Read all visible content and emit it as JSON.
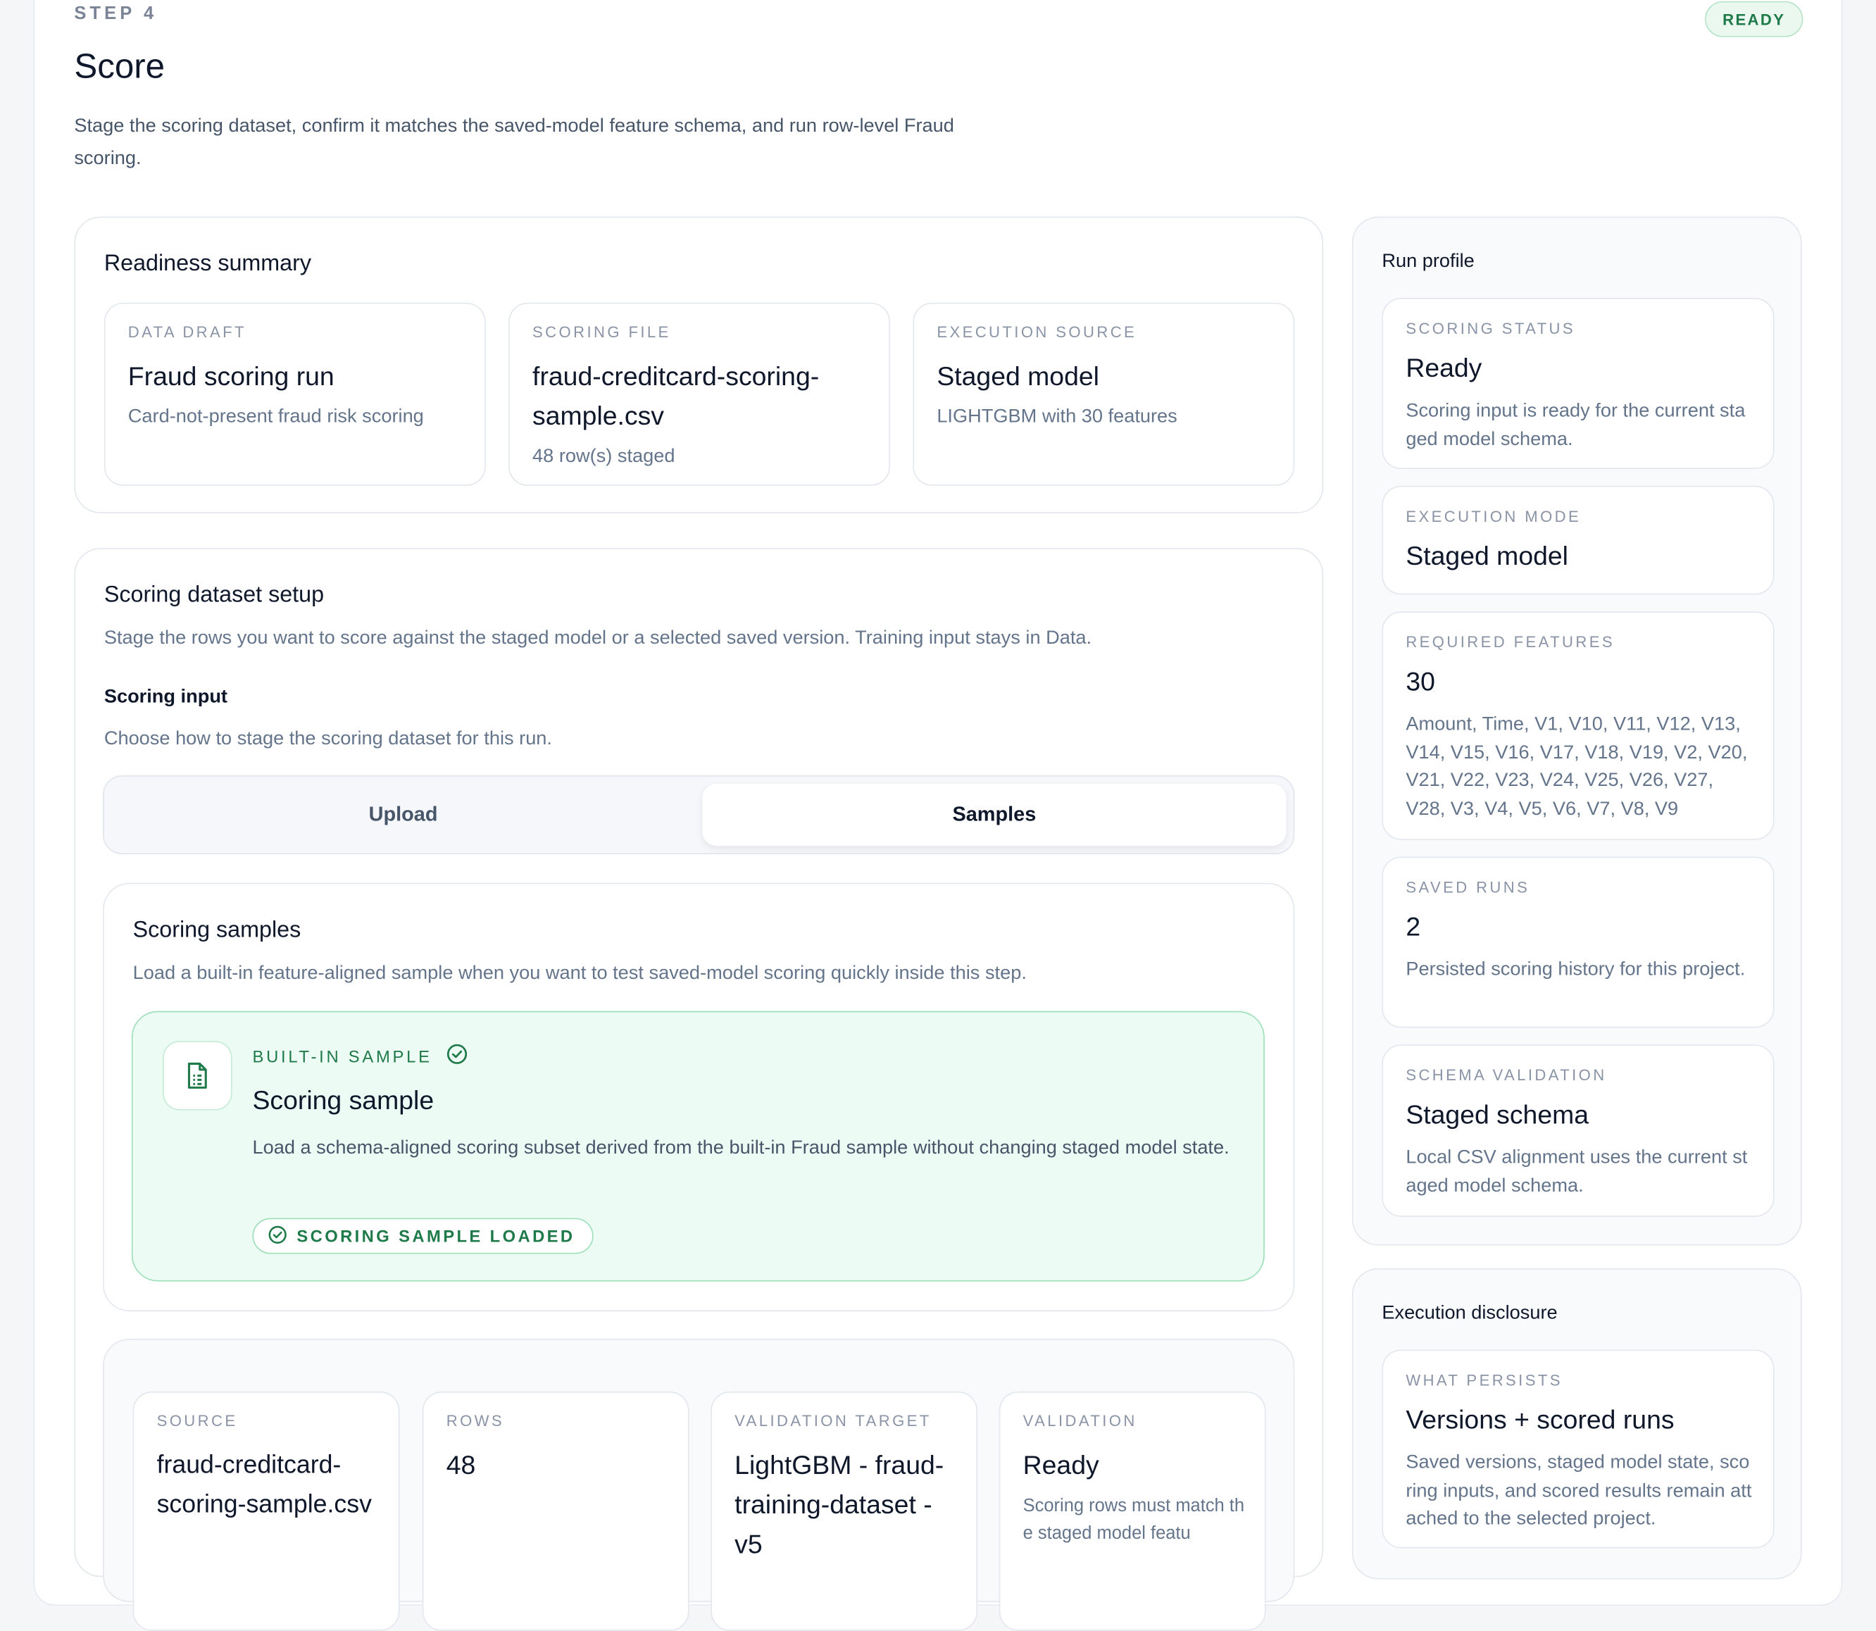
{
  "header": {
    "step": "STEP 4",
    "status_badge": "READY",
    "title": "Score",
    "description": "Stage the scoring dataset, confirm it matches the saved-model feature schema, and run row-level Fraud scoring."
  },
  "readiness": {
    "title": "Readiness summary",
    "tiles": [
      {
        "label": "DATA DRAFT",
        "value": "Fraud scoring run",
        "sub": "Card-not-present fraud risk scoring"
      },
      {
        "label": "SCORING FILE",
        "value": "fraud-creditcard-scoring-sample.csv",
        "sub": "48 row(s) staged"
      },
      {
        "label": "EXECUTION SOURCE",
        "value": "Staged model",
        "sub": "LIGHTGBM with 30 features"
      }
    ]
  },
  "setup": {
    "title": "Scoring dataset setup",
    "description": "Stage the rows you want to score against the staged model or a selected saved version. Training input stays in Data.",
    "input_title": "Scoring input",
    "input_description": "Choose how to stage the scoring dataset for this run.",
    "tabs": [
      {
        "label": "Upload",
        "active": false
      },
      {
        "label": "Samples",
        "active": true
      }
    ]
  },
  "samples": {
    "title": "Scoring samples",
    "description": "Load a built-in feature-aligned sample when you want to test saved-model scoring quickly inside this step.",
    "card": {
      "eyebrow": "BUILT-IN SAMPLE",
      "title": "Scoring sample",
      "description": "Load a schema-aligned scoring subset derived from the built-in Fraud sample without changing staged model state.",
      "status": "SCORING SAMPLE LOADED"
    }
  },
  "staged": {
    "tiles": [
      {
        "label": "SOURCE",
        "value": "fraud-creditcard-scoring-sample.csv",
        "sub": ""
      },
      {
        "label": "ROWS",
        "value": "48",
        "sub": ""
      },
      {
        "label": "VALIDATION TARGET",
        "value": "LightGBM - fraud-training-dataset - v5",
        "sub": ""
      },
      {
        "label": "VALIDATION",
        "value": "Ready",
        "sub": "Scoring rows must match the staged model featu"
      }
    ]
  },
  "run_profile": {
    "title": "Run profile",
    "tiles": [
      {
        "label": "SCORING STATUS",
        "value": "Ready",
        "sub": "Scoring input is ready for the current staged model schema."
      },
      {
        "label": "EXECUTION MODE",
        "value": "Staged model",
        "sub": ""
      },
      {
        "label": "REQUIRED FEATURES",
        "value": "30",
        "sub": "Amount, Time, V1, V10, V11, V12, V13, V14, V15, V16, V17, V18, V19, V2, V20, V21, V22, V23, V24, V25, V26, V27, V28, V3, V4, V5, V6, V7, V8, V9"
      },
      {
        "label": "SAVED RUNS",
        "value": "2",
        "sub": "Persisted scoring history for this project."
      },
      {
        "label": "SCHEMA VALIDATION",
        "value": "Staged schema",
        "sub": "Local CSV alignment uses the current staged model schema."
      }
    ]
  },
  "disclosure": {
    "title": "Execution disclosure",
    "tile": {
      "label": "WHAT PERSISTS",
      "value": "Versions + scored runs",
      "sub": "Saved versions, staged model state, scoring inputs, and scored results remain attached to the selected project."
    }
  },
  "colors": {
    "accent_green": "#1f7a4a",
    "sample_bg": "#ecfbf3",
    "border": "#e4e8ee"
  },
  "icons": {
    "sample_icon": "file-spreadsheet-icon",
    "check": "check-circle-icon"
  }
}
